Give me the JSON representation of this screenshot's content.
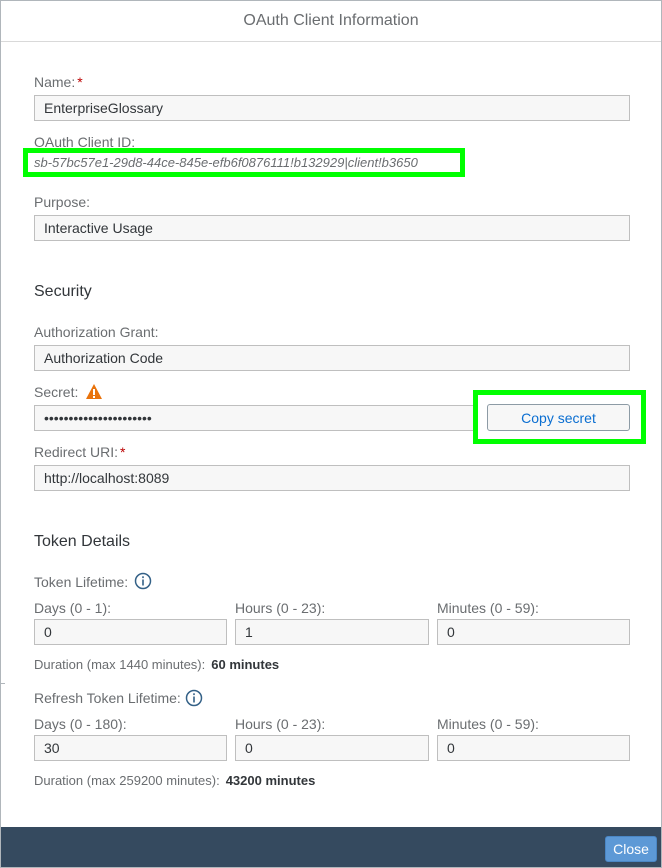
{
  "dialog": {
    "title": "OAuth Client Information"
  },
  "name": {
    "label": "Name:",
    "required_mark": "*",
    "value": "EnterpriseGlossary"
  },
  "client_id": {
    "label": "OAuth Client ID:",
    "value": "sb-57bc57e1-29d8-44ce-845e-efb6f0876111!b132929|client!b3650"
  },
  "purpose": {
    "label": "Purpose:",
    "value": "Interactive Usage"
  },
  "security": {
    "title": "Security",
    "grant": {
      "label": "Authorization Grant:",
      "value": "Authorization Code"
    },
    "secret": {
      "label": "Secret:",
      "value": "••••••••••••••••••••••",
      "copy_label": "Copy secret"
    },
    "redirect": {
      "label": "Redirect URI:",
      "required_mark": "*",
      "value": "http://localhost:8089"
    }
  },
  "token": {
    "title": "Token Details",
    "lifetime_label": "Token Lifetime:",
    "days": {
      "label": "Days (0 - 1):",
      "value": "0"
    },
    "hours": {
      "label": "Hours (0 - 23):",
      "value": "1"
    },
    "minutes": {
      "label": "Minutes (0 - 59):",
      "value": "0"
    },
    "duration_label": "Duration (max 1440 minutes):",
    "duration_value": "60 minutes"
  },
  "refresh": {
    "lifetime_label": "Refresh Token Lifetime:",
    "days": {
      "label": "Days (0 - 180):",
      "value": "30"
    },
    "hours": {
      "label": "Hours (0 - 23):",
      "value": "0"
    },
    "minutes": {
      "label": "Minutes (0 - 59):",
      "value": "0"
    },
    "duration_label": "Duration (max 259200 minutes):",
    "duration_value": "43200 minutes"
  },
  "footer": {
    "close_label": "Close"
  },
  "icons": {
    "warning": "warning-icon",
    "info": "info-icon"
  },
  "colors": {
    "highlight": "#00ff00",
    "accent": "#0a6ed1",
    "footer": "#354a5f",
    "warning": "#e9730c",
    "required": "#bb0000"
  }
}
